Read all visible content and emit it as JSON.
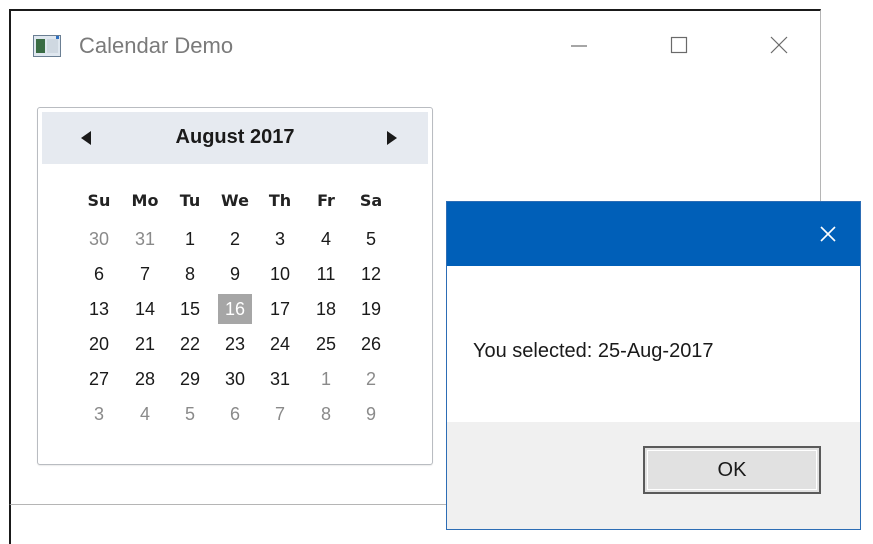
{
  "window": {
    "title": "Calendar Demo",
    "icon": "app-window-icon"
  },
  "calendar": {
    "month_title": "August 2017",
    "prev_icon": "triangle-left-icon",
    "next_icon": "triangle-right-icon",
    "weekdays": [
      "Su",
      "Mo",
      "Tu",
      "We",
      "Th",
      "Fr",
      "Sa"
    ],
    "weeks": [
      [
        "30",
        "31",
        "1",
        "2",
        "3",
        "4",
        "5"
      ],
      [
        "6",
        "7",
        "8",
        "9",
        "10",
        "11",
        "12"
      ],
      [
        "13",
        "14",
        "15",
        "16",
        "17",
        "18",
        "19"
      ],
      [
        "20",
        "21",
        "22",
        "23",
        "24",
        "25",
        "26"
      ],
      [
        "27",
        "28",
        "29",
        "30",
        "31",
        "1",
        "2"
      ],
      [
        "3",
        "4",
        "5",
        "6",
        "7",
        "8",
        "9"
      ]
    ],
    "selected_day": "16",
    "colors": {
      "header_bg": "#e6eaf0",
      "selected_bg": "#a6a6a6",
      "muted_text": "#8a8a8a"
    }
  },
  "dialog": {
    "message": "You selected: 25-Aug-2017",
    "ok_label": "OK",
    "colors": {
      "titlebar": "#005fb8",
      "footer": "#f0f0f0"
    }
  }
}
